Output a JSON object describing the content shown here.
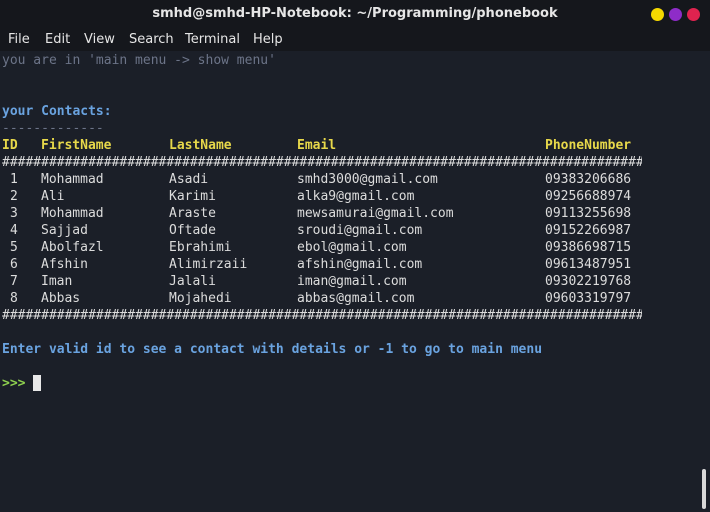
{
  "window": {
    "title": "smhd@smhd-HP-Notebook: ~/Programming/phonebook",
    "buttons": [
      {
        "name": "minimize",
        "color": "#f5d800"
      },
      {
        "name": "maximize",
        "color": "#8e2cc8"
      },
      {
        "name": "close",
        "color": "#e0234f"
      }
    ]
  },
  "menu": [
    "File",
    "Edit",
    "View",
    "Search",
    "Terminal",
    "Help"
  ],
  "terminal": {
    "status_line": "you are in 'main menu -> show menu'",
    "contacts_title": "your Contacts:",
    "underline": "-------------",
    "headers": [
      "ID",
      "FirstName",
      "LastName",
      "Email",
      "PhoneNumber"
    ],
    "separator": "################################################################################################",
    "rows": [
      [
        "1",
        "Mohammad",
        "Asadi",
        "smhd3000@gmail.com",
        "09383206686"
      ],
      [
        "2",
        "Ali",
        "Karimi",
        "alka9@gmail.com",
        "09256688974"
      ],
      [
        "3",
        "Mohammad",
        "Araste",
        "mewsamurai@gmail.com",
        "09113255698"
      ],
      [
        "4",
        "Sajjad",
        "Oftade",
        "sroudi@gmail.com",
        "09152266987"
      ],
      [
        "5",
        "Abolfazl",
        "Ebrahimi",
        "ebol@gmail.com",
        "09386698715"
      ],
      [
        "6",
        "Afshin",
        "Alimirzaii",
        "afshin@gmail.com",
        "09613487951"
      ],
      [
        "7",
        "Iman",
        "Jalali",
        "iman@gmail.com",
        "09302219768"
      ],
      [
        "8",
        "Abbas",
        "Mojahedi",
        "abbas@gmail.com",
        "09603319797"
      ]
    ],
    "instruction": "Enter valid id to see a contact with details or -1 to go to main menu",
    "prompt": ">>>"
  }
}
